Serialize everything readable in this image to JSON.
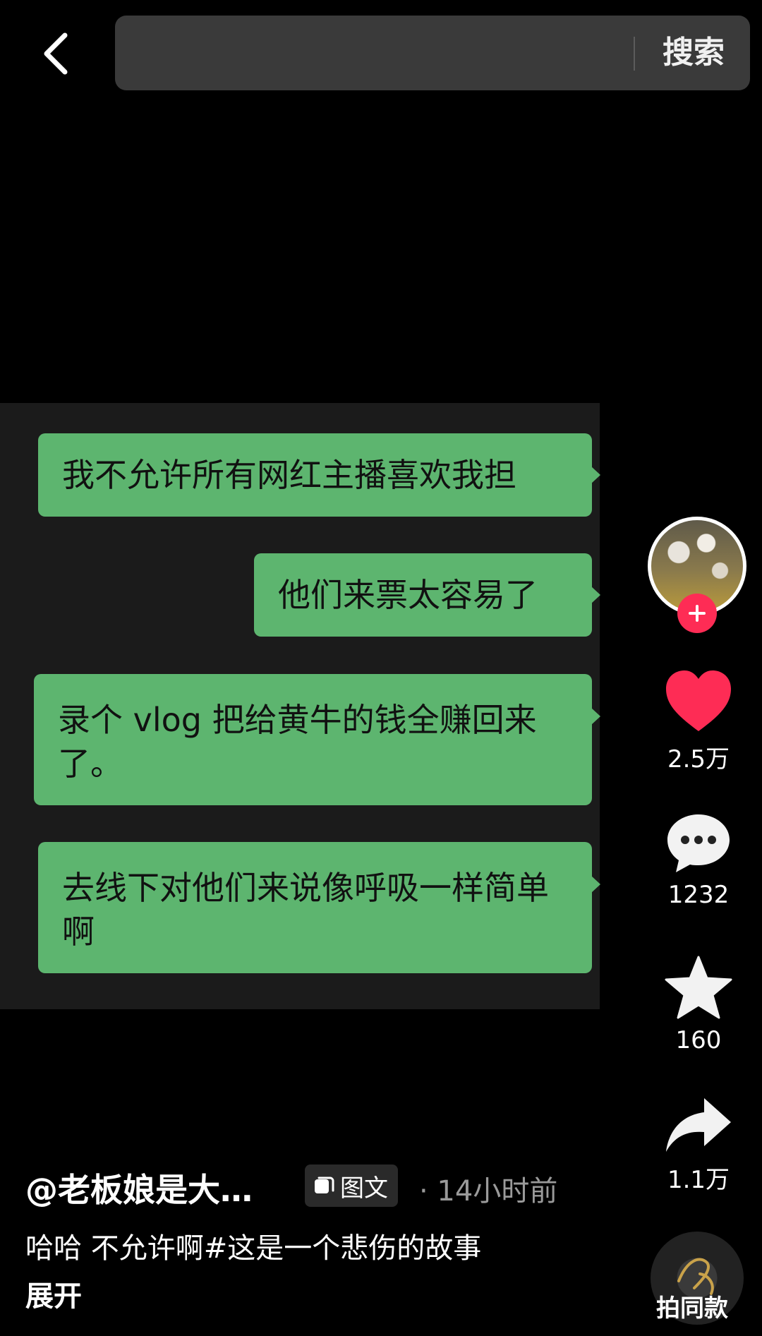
{
  "header": {
    "search_placeholder": "",
    "search_button_label": "搜索"
  },
  "chat": {
    "messages": [
      "我不允许所有网红主播喜欢我担",
      "他们来票太容易了",
      "录个 vlog 把给黄牛的钱全赚回来了。",
      "去线下对他们来说像呼吸一样简单啊"
    ],
    "bubble_color": "#5db56f"
  },
  "actions": {
    "likes": "2.5万",
    "comments": "1232",
    "favorites": "160",
    "shares": "1.1万",
    "like_color": "#fe2c55",
    "music_label": "拍同款"
  },
  "post": {
    "author": "@老板娘是大…",
    "type_badge": "图文",
    "time": "· 14小时前",
    "description": "哈哈 不允许啊#这是一个悲伤的故事",
    "expand_label": "展开"
  }
}
